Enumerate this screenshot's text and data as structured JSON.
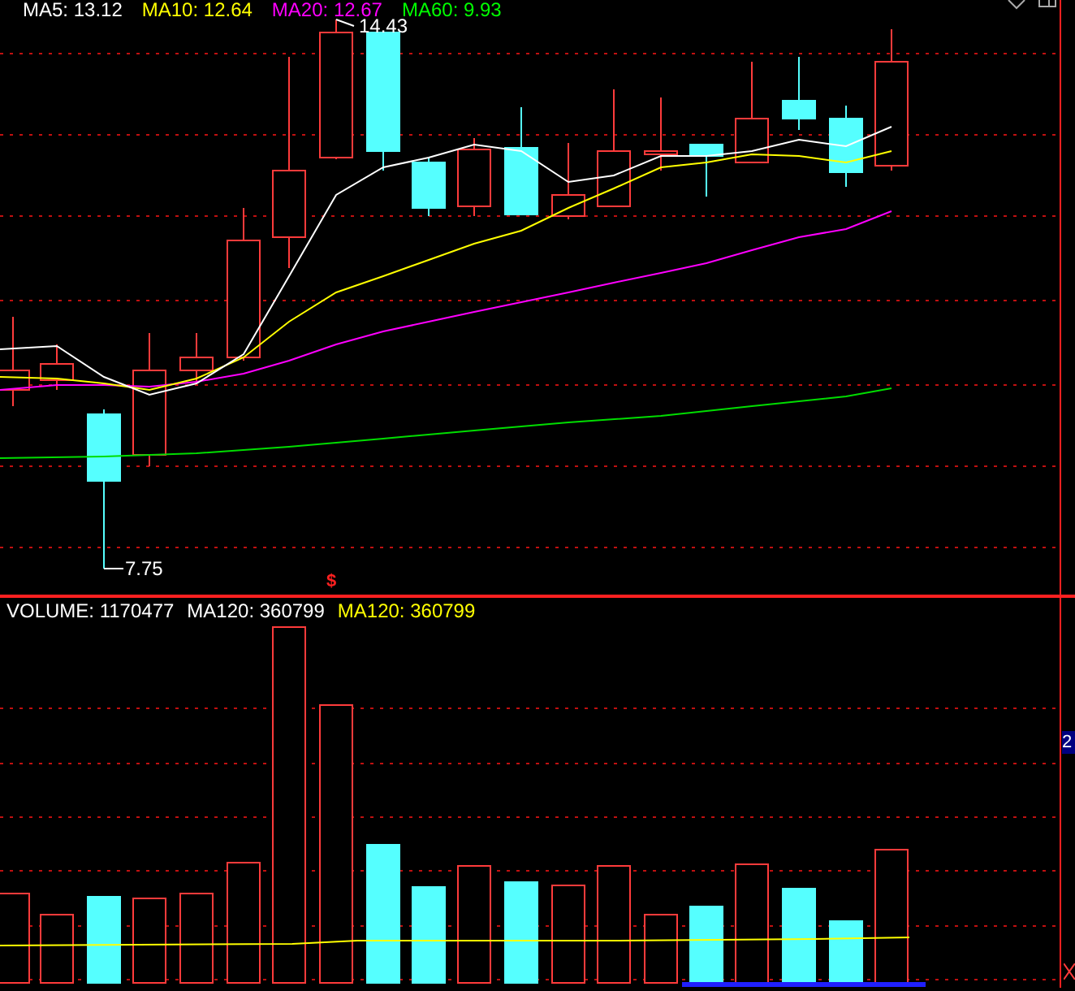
{
  "price_legend": [
    {
      "label": "MA5: 13.12",
      "color": "#ffffff"
    },
    {
      "label": "MA10: 12.64",
      "color": "#ffff00"
    },
    {
      "label": "MA20: 12.67",
      "color": "#ff00ff"
    },
    {
      "label": "MA60: 9.93",
      "color": "#00ff00"
    }
  ],
  "high_label": "14.43",
  "low_label": "7.75",
  "event_marker": "$",
  "volume_legend": [
    {
      "label": "VOLUME: 1170477",
      "color": "#ffffff"
    },
    {
      "label": "MA120: 360799",
      "color": "#ffffff"
    },
    {
      "label": "MA120: 360799",
      "color": "#ffff00"
    }
  ],
  "axis_badge": "2"
}
